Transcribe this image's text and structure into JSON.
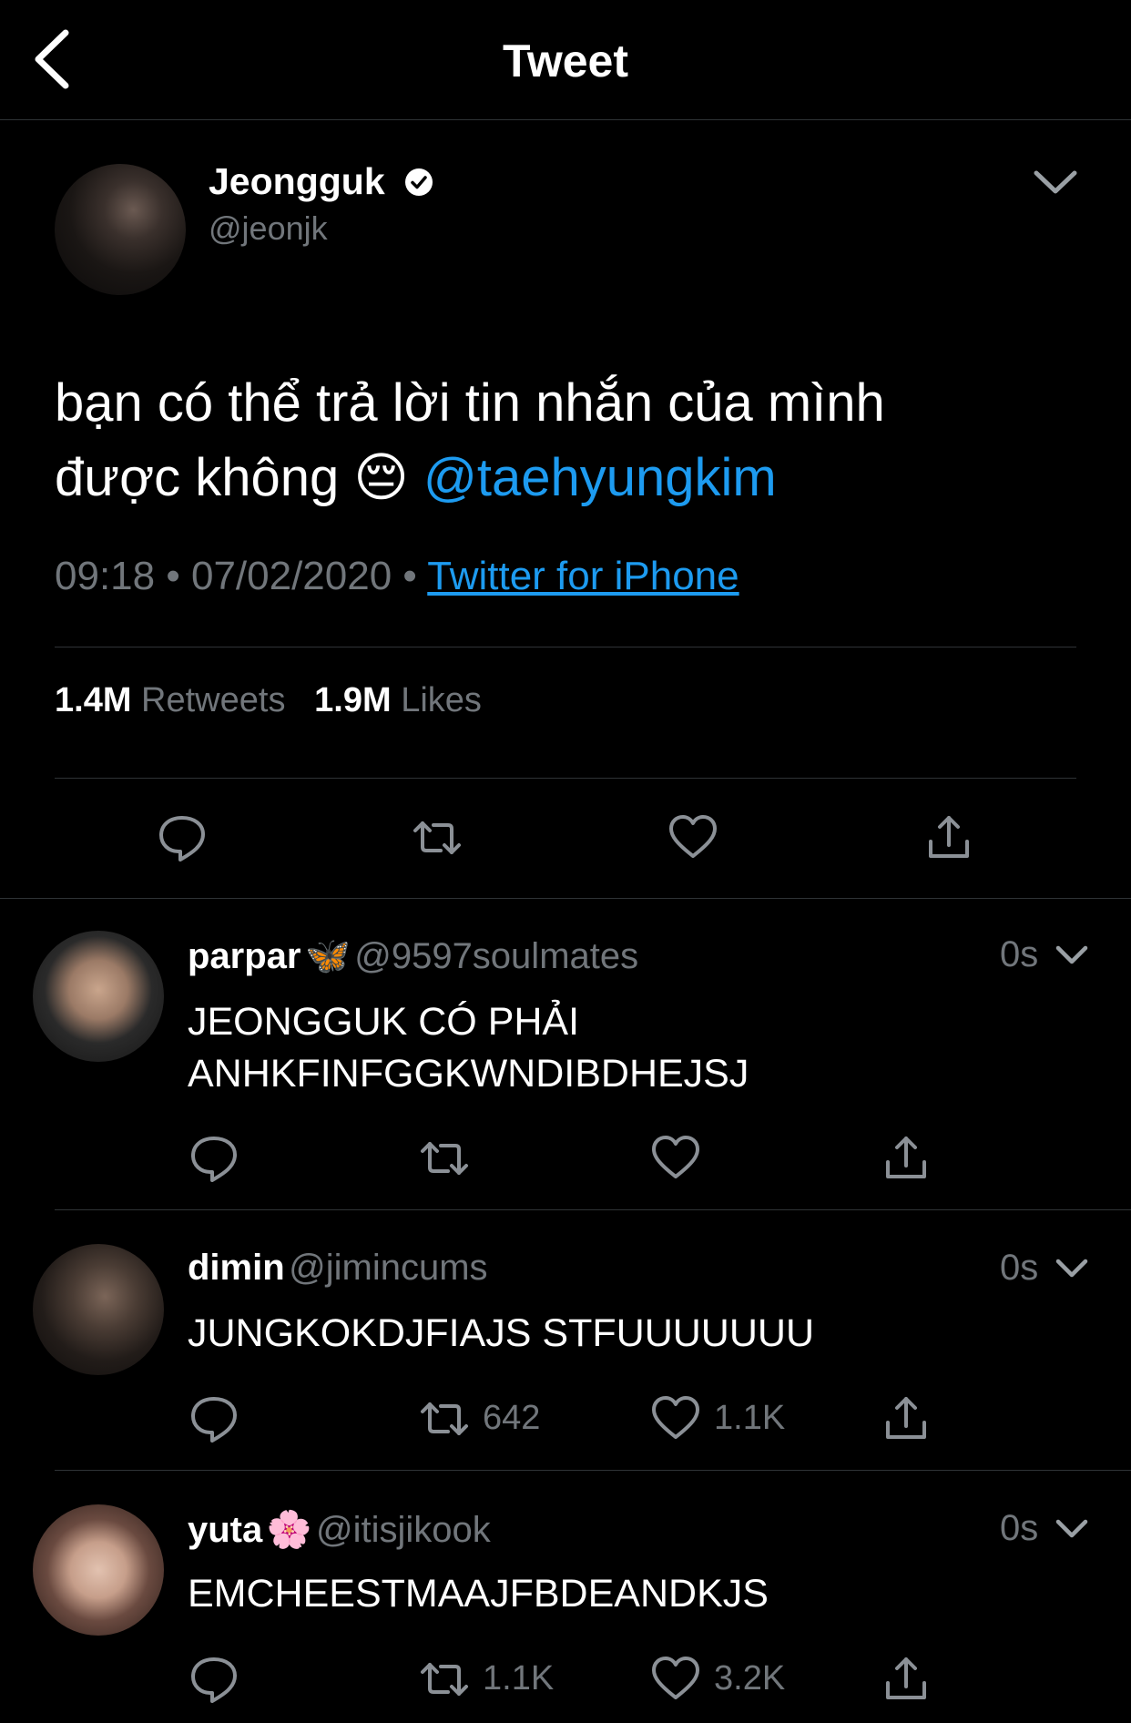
{
  "header": {
    "title": "Tweet",
    "back_icon": "chevron-left-icon"
  },
  "tweet": {
    "name": "Jeongguk",
    "handle": "@jeonjk",
    "text_line1": "bạn có thể trả lời tin nhắn của mình",
    "text_line2": "được không 😔",
    "mention": "@taehyungkim",
    "time": "09:18",
    "date": "07/02/2020",
    "source": "Twitter for iPhone",
    "retweets_count": "1.4M",
    "retweets_label": "Retweets",
    "likes_count": "1.9M",
    "likes_label": "Likes"
  },
  "replies": [
    {
      "name": "parpar",
      "emoji": "🦋",
      "handle": "@9597soulmates",
      "time": "0s",
      "text_line1": "JEONGGUK CÓ PHẢI",
      "text_line2": "ANHKFINFGGKWNDIBDHEJSJ",
      "retweets": "",
      "likes": ""
    },
    {
      "name": "dimin",
      "emoji": "",
      "handle": "@jimincums",
      "time": "0s",
      "text_line1": "JUNGKOKDJFIAJS STFUUUUUUU",
      "text_line2": "",
      "retweets": "642",
      "likes": "1.1K"
    },
    {
      "name": "yuta",
      "emoji": "🌸",
      "handle": "@itisjikook",
      "time": "0s",
      "text_line1": "EMCHEESTMAAJFBDEANDKJS",
      "text_line2": "",
      "retweets": "1.1K",
      "likes": "3.2K"
    }
  ],
  "colors": {
    "background": "#000000",
    "accent": "#1d9bf0",
    "muted": "#71767b",
    "divider": "#2f3336"
  }
}
